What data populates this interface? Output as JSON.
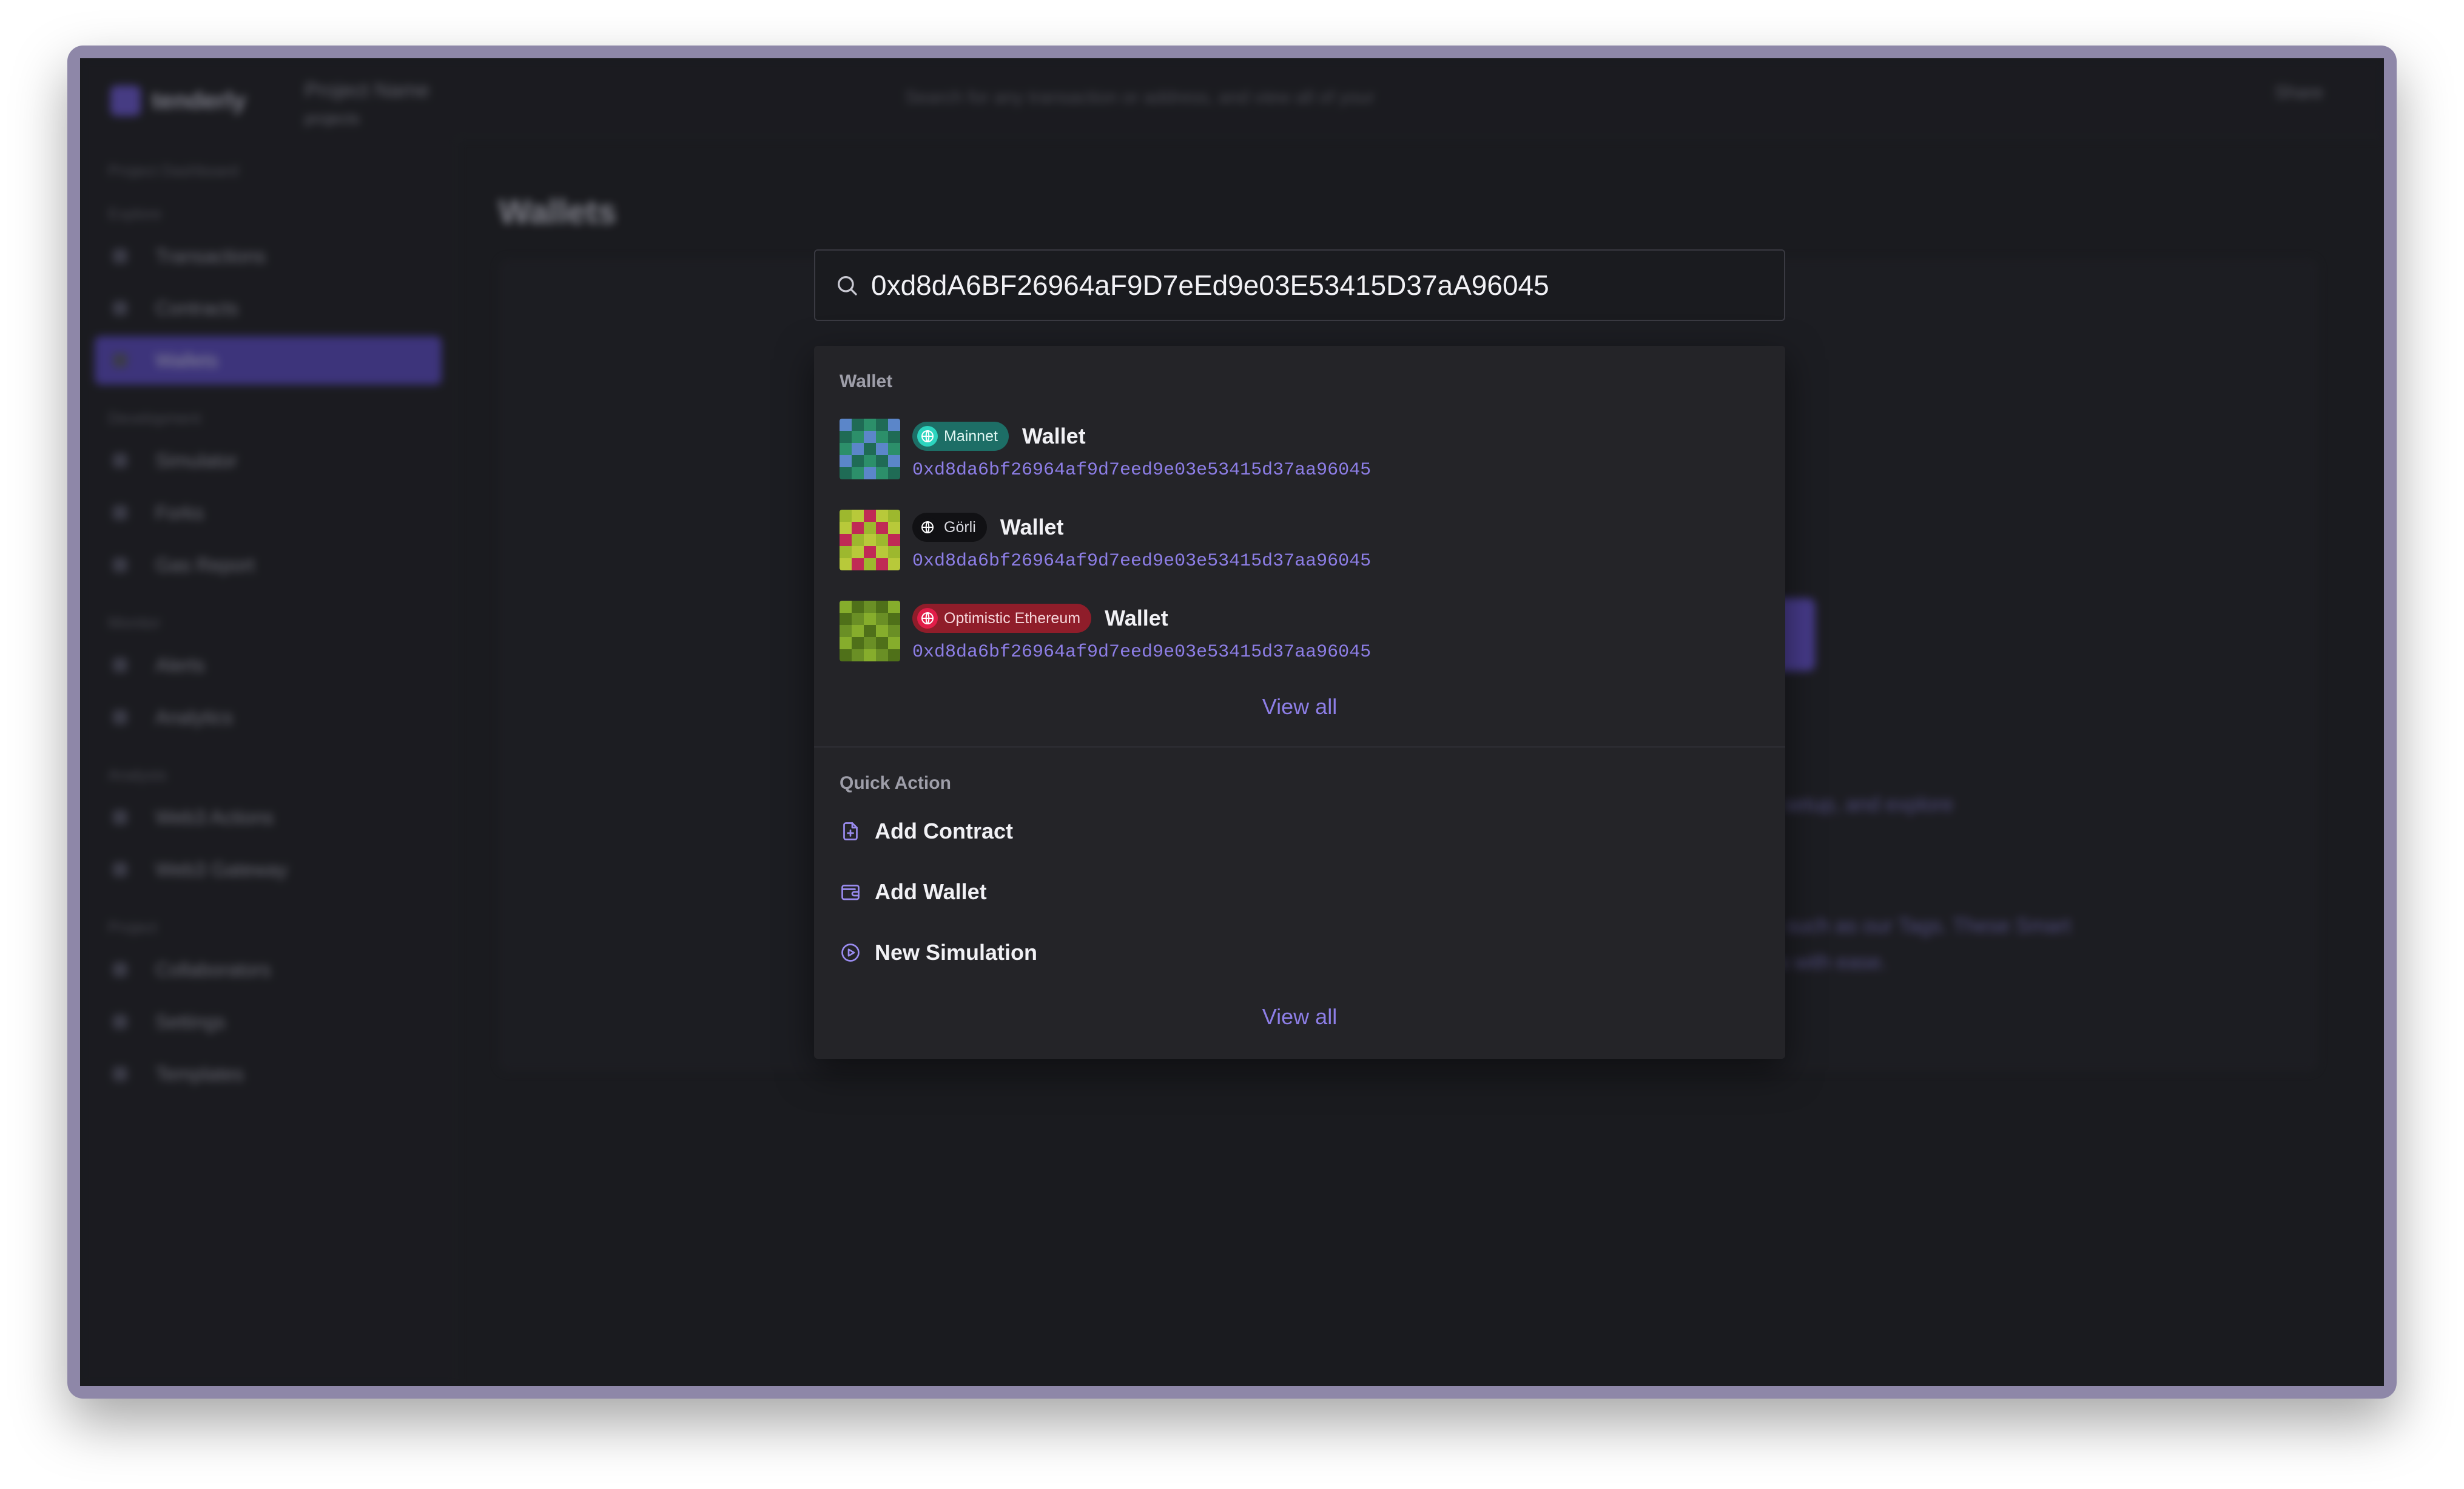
{
  "background_app": {
    "logo_text": "tenderly",
    "project_name": "Project Name",
    "project_sub": "projects",
    "search_placeholder": "Search for any transaction or address, and view all of your",
    "top_right_label": "Share",
    "page_title": "Wallets",
    "sidebar": [
      {
        "section": "Project Dashboard",
        "items": []
      },
      {
        "section": "Explore",
        "items": [
          "Transactions",
          "Contracts",
          "Wallets"
        ]
      },
      {
        "section": "Development",
        "items": [
          "Simulator",
          "Forks",
          "Gas Report"
        ]
      },
      {
        "section": "Monitor",
        "items": [
          "Alerts",
          "Analytics"
        ]
      },
      {
        "section": "Analysis",
        "items": [
          "Web3 Actions",
          "Web3 Gateway"
        ]
      },
      {
        "section": "Project",
        "items": [
          "Collaborators",
          "Settings",
          "Templates"
        ]
      }
    ],
    "active_item": "Wallets",
    "bg_paragraph_1": "tracking setup, and explore",
    "bg_paragraph_2": "features such as our Tags. These Smart functions with ease."
  },
  "search": {
    "value": "0xd8dA6BF26964aF9D7eEd9e03E53415D37aA96045"
  },
  "wallet_section": {
    "label": "Wallet",
    "items": [
      {
        "network": "Mainnet",
        "name": "Wallet",
        "address": "0xd8da6bf26964af9d7eed9e03e53415d37aa96045",
        "badge_bg": "#1d6e66",
        "badge_fg": "#dff6f2",
        "globe_bg": "#2dd4bf"
      },
      {
        "network": "Görli",
        "name": "Wallet",
        "address": "0xd8da6bf26964af9d7eed9e03e53415d37aa96045",
        "badge_bg": "#111114",
        "badge_fg": "#d8d8de",
        "globe_bg": "#111114"
      },
      {
        "network": "Optimistic Ethereum",
        "name": "Wallet",
        "address": "0xd8da6bf26964af9d7eed9e03e53415d37aa96045",
        "badge_bg": "#8f1d2a",
        "badge_fg": "#f6d7db",
        "globe_bg": "#e11d48"
      }
    ],
    "view_all": "View all"
  },
  "quick_action_section": {
    "label": "Quick Action",
    "actions": [
      {
        "label": "Add Contract",
        "icon": "file-plus-icon"
      },
      {
        "label": "Add Wallet",
        "icon": "wallet-icon"
      },
      {
        "label": "New Simulation",
        "icon": "play-circle-icon"
      }
    ],
    "view_all": "View all"
  },
  "colors": {
    "accent": "#8d7ee6",
    "panel": "#242428",
    "backdrop": "#1a1b1f"
  }
}
